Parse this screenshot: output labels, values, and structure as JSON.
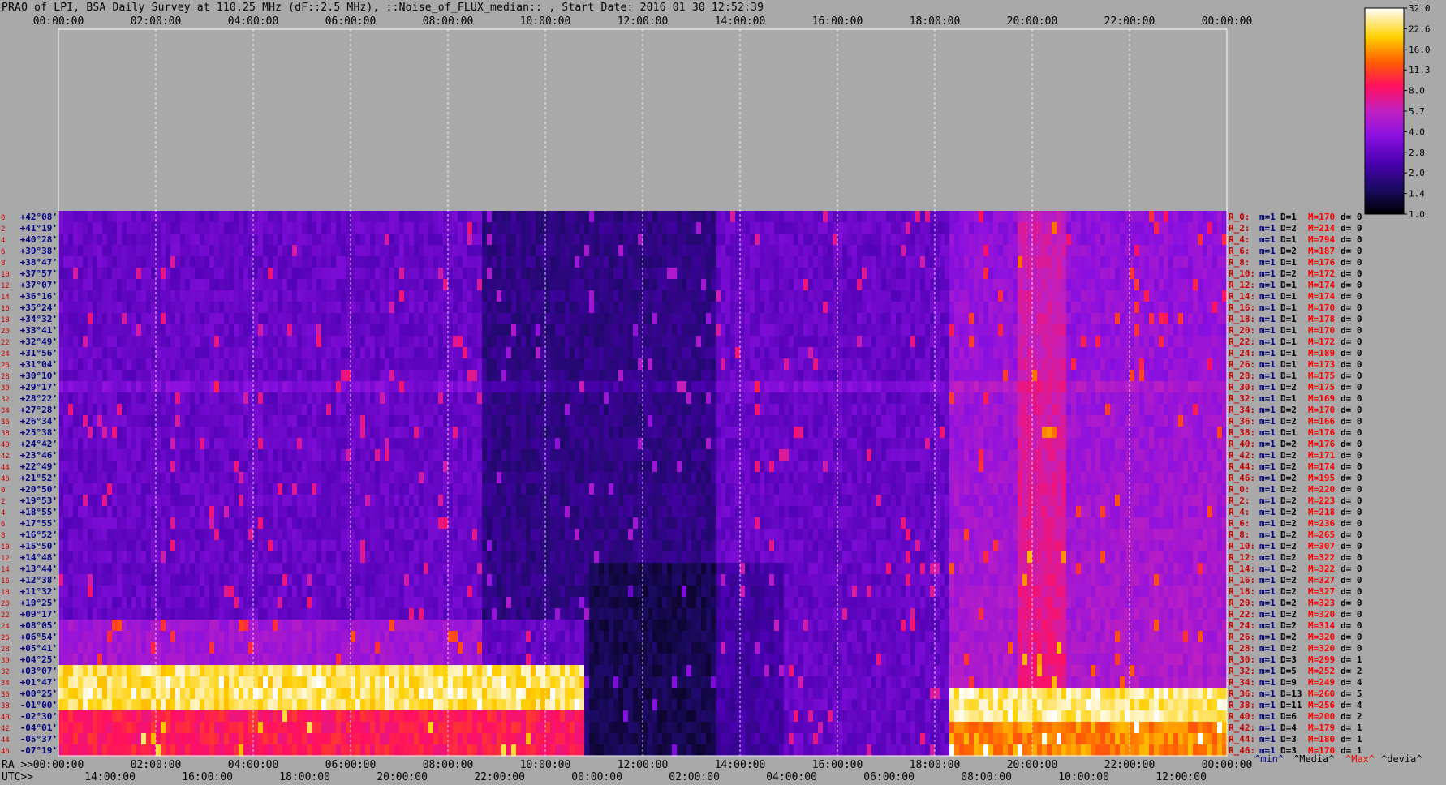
{
  "title": "PRAO of LPI, BSA Daily Survey at 110.25 MHz (dF::2.5 MHz), ::Noise_of_FLUX_median:: , Start Date: 2016 01 30 12:52:39",
  "chart_data": {
    "type": "heatmap",
    "title": "PRAO of LPI, BSA Daily Survey at 110.25 MHz (dF::2.5 MHz), ::Noise_of_FLUX_median:: , Start Date: 2016 01 30 12:52:39",
    "top_time_ticks": [
      "00:00:00",
      "02:00:00",
      "04:00:00",
      "06:00:00",
      "08:00:00",
      "10:00:00",
      "12:00:00",
      "14:00:00",
      "16:00:00",
      "18:00:00",
      "20:00:00",
      "22:00:00",
      "00:00:00"
    ],
    "bottom_ra_prefix": "RA >>",
    "bottom_ra_ticks": [
      "00:00:00",
      "02:00:00",
      "04:00:00",
      "06:00:00",
      "08:00:00",
      "10:00:00",
      "12:00:00",
      "14:00:00",
      "16:00:00",
      "18:00:00",
      "20:00:00",
      "22:00:00",
      "00:00:00"
    ],
    "bottom_utc_prefix": "UTC>>",
    "bottom_utc_ticks": [
      "14:00:00",
      "16:00:00",
      "18:00:00",
      "20:00:00",
      "22:00:00",
      "00:00:00",
      "02:00:00",
      "04:00:00",
      "06:00:00",
      "08:00:00",
      "10:00:00",
      "12:00:00"
    ],
    "declinations": [
      "+42°08'",
      "+41°19'",
      "+40°28'",
      "+39°38'",
      "+38°47'",
      "+37°57'",
      "+37°07'",
      "+36°16'",
      "+35°24'",
      "+34°32'",
      "+33°41'",
      "+32°49'",
      "+31°56'",
      "+31°04'",
      "+30°10'",
      "+29°17'",
      "+28°22'",
      "+27°28'",
      "+26°34'",
      "+25°38'",
      "+24°42'",
      "+23°46'",
      "+22°49'",
      "+21°52'",
      "+20°50'",
      "+19°53'",
      "+18°55'",
      "+17°55'",
      "+16°52'",
      "+15°50'",
      "+14°48'",
      "+13°44'",
      "+12°38'",
      "+11°32'",
      "+10°25'",
      "+09°17'",
      "+08°05'",
      "+06°54'",
      "+05°41'",
      "+04°25'",
      "+03°07'",
      "+01°47'",
      "+00°25'",
      "-01°00'",
      "-02°30'",
      "-04°01'",
      "-05°37'",
      "-07°19'"
    ],
    "ray_numbers": [
      "0",
      "2",
      "4",
      "6",
      "8",
      "10",
      "12",
      "14",
      "16",
      "18",
      "20",
      "22",
      "24",
      "26",
      "28",
      "30",
      "32",
      "34",
      "36",
      "38",
      "40",
      "42",
      "44",
      "46",
      "0",
      "2",
      "4",
      "6",
      "8",
      "10",
      "12",
      "14",
      "16",
      "18",
      "20",
      "22",
      "24",
      "26",
      "28",
      "30",
      "32",
      "34",
      "36",
      "38",
      "40",
      "42",
      "44",
      "46"
    ],
    "row_stats": [
      {
        "ray": "R_0:",
        "m": "m=1",
        "D": "D=1",
        "M": "M=170",
        "d": "d= 0"
      },
      {
        "ray": "R_2:",
        "m": "m=1",
        "D": "D=2",
        "M": "M=214",
        "d": "d= 0"
      },
      {
        "ray": "R_4:",
        "m": "m=1",
        "D": "D=1",
        "M": "M=794",
        "d": "d= 0"
      },
      {
        "ray": "R_6:",
        "m": "m=1",
        "D": "D=2",
        "M": "M=187",
        "d": "d= 0"
      },
      {
        "ray": "R_8:",
        "m": "m=1",
        "D": "D=1",
        "M": "M=176",
        "d": "d= 0"
      },
      {
        "ray": "R_10:",
        "m": "m=1",
        "D": "D=2",
        "M": "M=172",
        "d": "d= 0"
      },
      {
        "ray": "R_12:",
        "m": "m=1",
        "D": "D=1",
        "M": "M=174",
        "d": "d= 0"
      },
      {
        "ray": "R_14:",
        "m": "m=1",
        "D": "D=1",
        "M": "M=174",
        "d": "d= 0"
      },
      {
        "ray": "R_16:",
        "m": "m=1",
        "D": "D=1",
        "M": "M=170",
        "d": "d= 0"
      },
      {
        "ray": "R_18:",
        "m": "m=1",
        "D": "D=1",
        "M": "M=178",
        "d": "d= 0"
      },
      {
        "ray": "R_20:",
        "m": "m=1",
        "D": "D=1",
        "M": "M=170",
        "d": "d= 0"
      },
      {
        "ray": "R_22:",
        "m": "m=1",
        "D": "D=1",
        "M": "M=172",
        "d": "d= 0"
      },
      {
        "ray": "R_24:",
        "m": "m=1",
        "D": "D=1",
        "M": "M=189",
        "d": "d= 0"
      },
      {
        "ray": "R_26:",
        "m": "m=1",
        "D": "D=1",
        "M": "M=173",
        "d": "d= 0"
      },
      {
        "ray": "R_28:",
        "m": "m=1",
        "D": "D=1",
        "M": "M=175",
        "d": "d= 0"
      },
      {
        "ray": "R_30:",
        "m": "m=1",
        "D": "D=2",
        "M": "M=175",
        "d": "d= 0"
      },
      {
        "ray": "R_32:",
        "m": "m=1",
        "D": "D=1",
        "M": "M=169",
        "d": "d= 0"
      },
      {
        "ray": "R_34:",
        "m": "m=1",
        "D": "D=2",
        "M": "M=170",
        "d": "d= 0"
      },
      {
        "ray": "R_36:",
        "m": "m=1",
        "D": "D=2",
        "M": "M=166",
        "d": "d= 0"
      },
      {
        "ray": "R_38:",
        "m": "m=1",
        "D": "D=1",
        "M": "M=176",
        "d": "d= 0"
      },
      {
        "ray": "R_40:",
        "m": "m=1",
        "D": "D=2",
        "M": "M=176",
        "d": "d= 0"
      },
      {
        "ray": "R_42:",
        "m": "m=1",
        "D": "D=2",
        "M": "M=171",
        "d": "d= 0"
      },
      {
        "ray": "R_44:",
        "m": "m=1",
        "D": "D=2",
        "M": "M=174",
        "d": "d= 0"
      },
      {
        "ray": "R_46:",
        "m": "m=1",
        "D": "D=2",
        "M": "M=195",
        "d": "d= 0"
      },
      {
        "ray": "R_0:",
        "m": "m=1",
        "D": "D=2",
        "M": "M=220",
        "d": "d= 0"
      },
      {
        "ray": "R_2:",
        "m": "m=1",
        "D": "D=2",
        "M": "M=223",
        "d": "d= 0"
      },
      {
        "ray": "R_4:",
        "m": "m=1",
        "D": "D=2",
        "M": "M=218",
        "d": "d= 0"
      },
      {
        "ray": "R_6:",
        "m": "m=1",
        "D": "D=2",
        "M": "M=236",
        "d": "d= 0"
      },
      {
        "ray": "R_8:",
        "m": "m=1",
        "D": "D=2",
        "M": "M=265",
        "d": "d= 0"
      },
      {
        "ray": "R_10:",
        "m": "m=1",
        "D": "D=2",
        "M": "M=307",
        "d": "d= 0"
      },
      {
        "ray": "R_12:",
        "m": "m=1",
        "D": "D=2",
        "M": "M=322",
        "d": "d= 0"
      },
      {
        "ray": "R_14:",
        "m": "m=1",
        "D": "D=2",
        "M": "M=322",
        "d": "d= 0"
      },
      {
        "ray": "R_16:",
        "m": "m=1",
        "D": "D=2",
        "M": "M=327",
        "d": "d= 0"
      },
      {
        "ray": "R_18:",
        "m": "m=1",
        "D": "D=2",
        "M": "M=327",
        "d": "d= 0"
      },
      {
        "ray": "R_20:",
        "m": "m=1",
        "D": "D=2",
        "M": "M=323",
        "d": "d= 0"
      },
      {
        "ray": "R_22:",
        "m": "m=1",
        "D": "D=2",
        "M": "M=320",
        "d": "d= 0"
      },
      {
        "ray": "R_24:",
        "m": "m=1",
        "D": "D=2",
        "M": "M=314",
        "d": "d= 0"
      },
      {
        "ray": "R_26:",
        "m": "m=1",
        "D": "D=2",
        "M": "M=320",
        "d": "d= 0"
      },
      {
        "ray": "R_28:",
        "m": "m=1",
        "D": "D=2",
        "M": "M=320",
        "d": "d= 0"
      },
      {
        "ray": "R_30:",
        "m": "m=1",
        "D": "D=3",
        "M": "M=299",
        "d": "d= 1"
      },
      {
        "ray": "R_32:",
        "m": "m=1",
        "D": "D=5",
        "M": "M=252",
        "d": "d= 2"
      },
      {
        "ray": "R_34:",
        "m": "m=1",
        "D": "D=9",
        "M": "M=249",
        "d": "d= 4"
      },
      {
        "ray": "R_36:",
        "m": "m=1",
        "D": "D=13",
        "M": "M=260",
        "d": "d= 5"
      },
      {
        "ray": "R_38:",
        "m": "m=1",
        "D": "D=11",
        "M": "M=256",
        "d": "d= 4"
      },
      {
        "ray": "R_40:",
        "m": "m=1",
        "D": "D=6",
        "M": "M=200",
        "d": "d= 2"
      },
      {
        "ray": "R_42:",
        "m": "m=1",
        "D": "D=4",
        "M": "M=179",
        "d": "d= 1"
      },
      {
        "ray": "R_44:",
        "m": "m=1",
        "D": "D=3",
        "M": "M=180",
        "d": "d= 1"
      },
      {
        "ray": "R_46:",
        "m": "m=1",
        "D": "D=3",
        "M": "M=170",
        "d": "d= 1"
      }
    ],
    "stats_legend": {
      "min": "^min^",
      "median": "^Media^",
      "max": "^Max^",
      "dev": "^devia^"
    },
    "colorbar": {
      "ticks": [
        "32.0",
        "22.6",
        "16.0",
        "11.3",
        "8.0",
        "5.7",
        "4.0",
        "2.8",
        "2.0",
        "1.4",
        "1.0"
      ],
      "range": [
        1.0,
        32.0
      ],
      "scale": "log"
    },
    "colors": {
      "background": "#a9a9a9",
      "dec_label": "#000080",
      "ray_label": "#cc0000",
      "stat_min": "#000080",
      "stat_D": "#000000",
      "stat_max": "#ff0000",
      "stat_dev": "#000000"
    }
  }
}
